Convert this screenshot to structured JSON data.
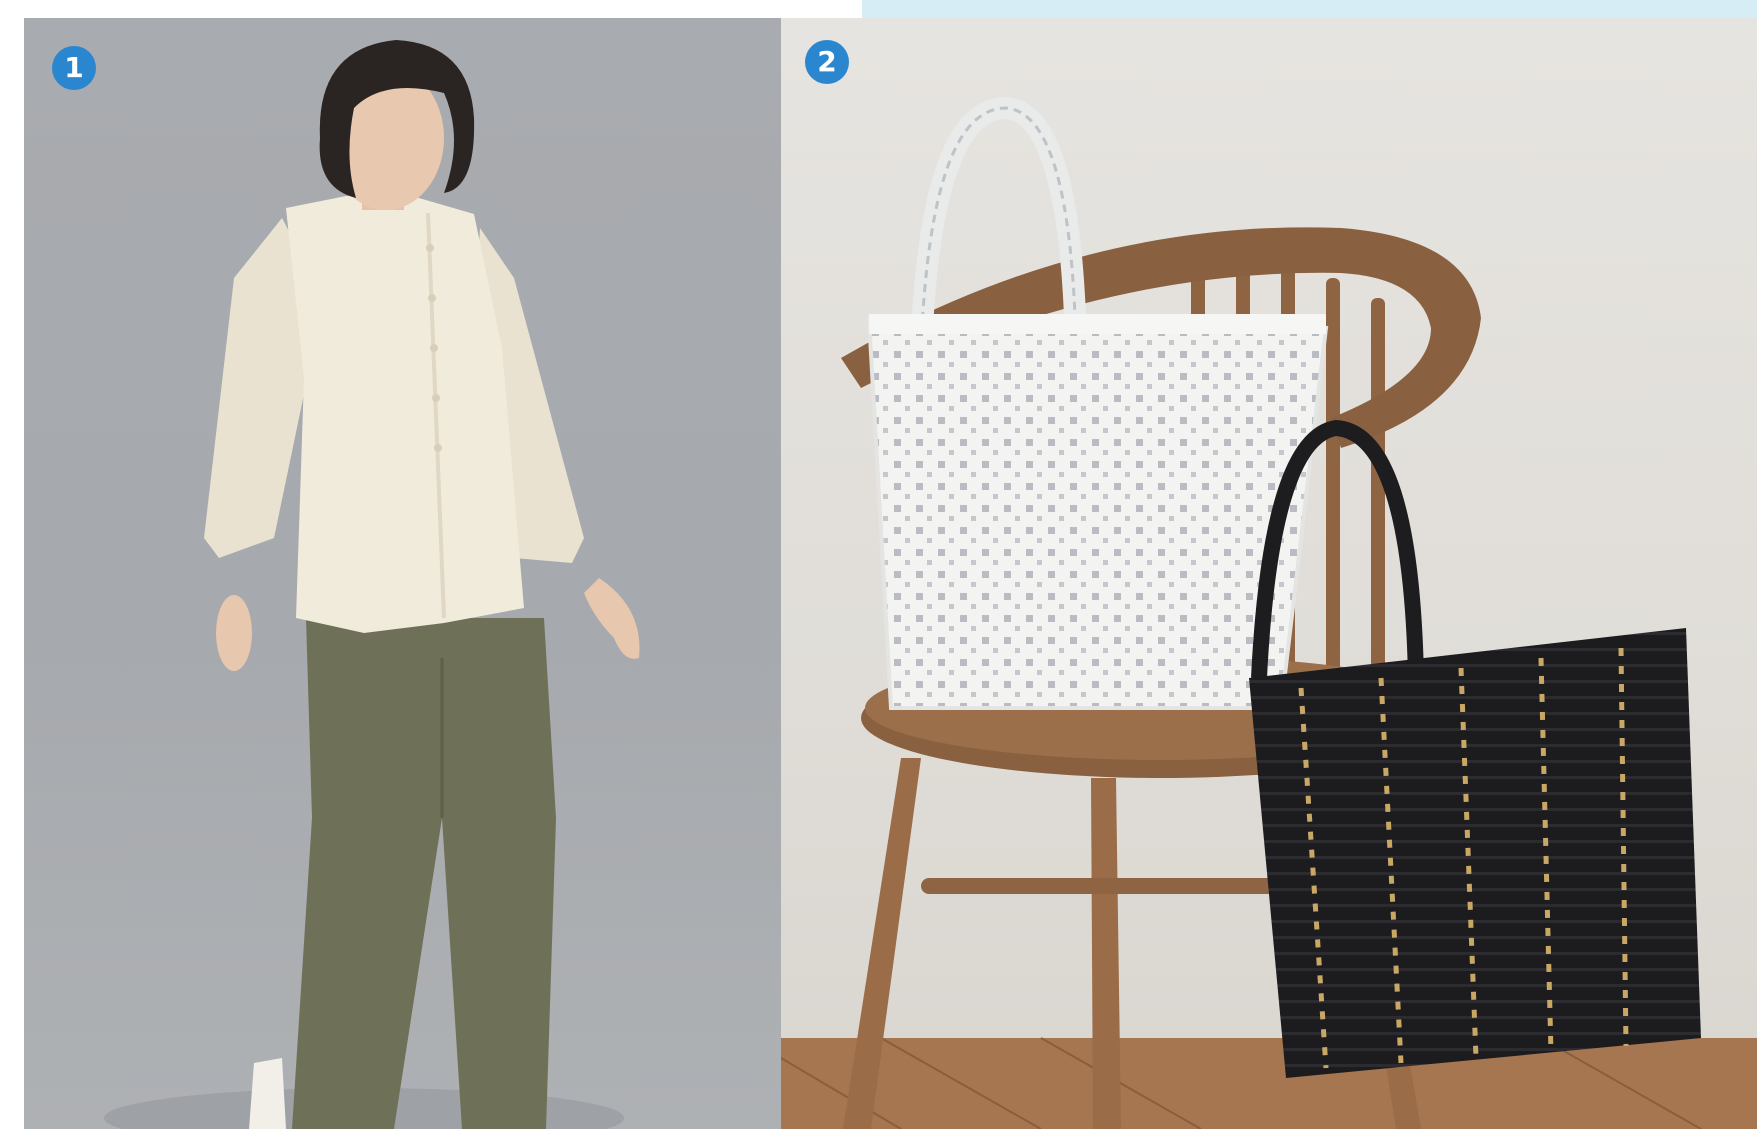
{
  "panels": [
    {
      "badge": "1",
      "subject": "model-blouse-pants"
    },
    {
      "badge": "2",
      "subject": "woven-tote-bags-on-chair"
    }
  ],
  "colors": {
    "badge_blue": "#2b86d0",
    "left_background": "#a8abaf",
    "right_background": "#e2dfda",
    "blouse": "#f1ebdc",
    "pants": "#6e7158",
    "white_tote": "#f2f2f0",
    "black_tote": "#1c1c1f",
    "tote_accent": "#c9a866",
    "chair_wood": "#8a6140",
    "top_strip": "#d7edf6"
  }
}
